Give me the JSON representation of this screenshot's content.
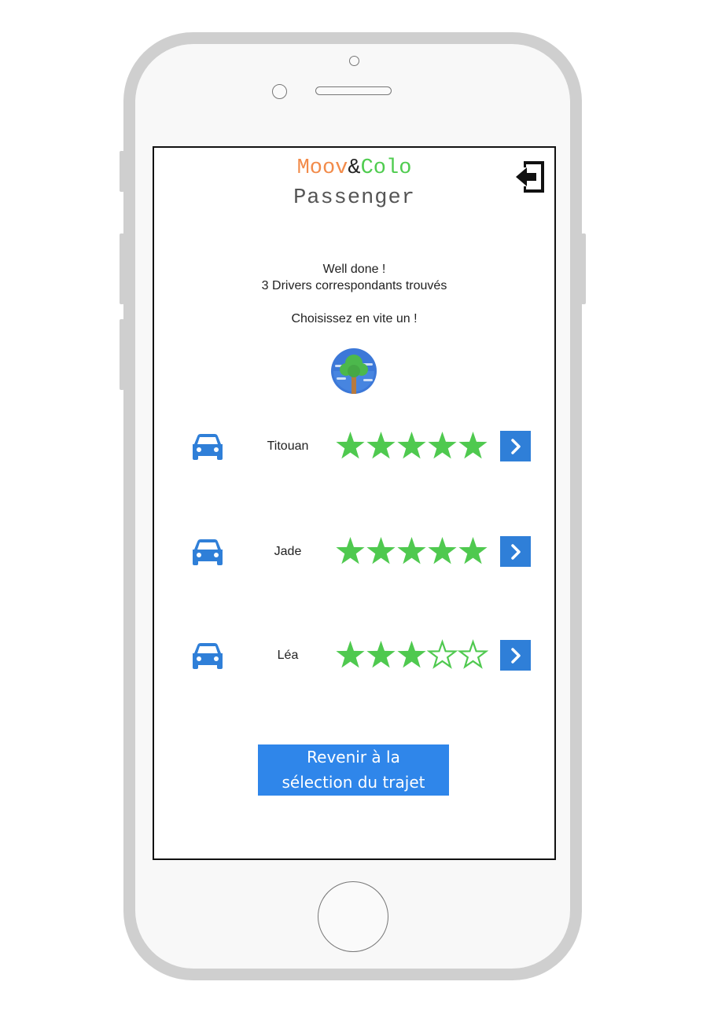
{
  "app": {
    "brand_part1": "Moov",
    "brand_amp": "&",
    "brand_part2": "Colo",
    "subtitle": "Passenger"
  },
  "message": {
    "line1": "Well done !",
    "line2": "3 Drivers correspondants trouvés",
    "line3": "Choisissez en vite un !"
  },
  "drivers": [
    {
      "name": "Titouan",
      "rating": 5,
      "max_rating": 5
    },
    {
      "name": "Jade",
      "rating": 5,
      "max_rating": 5
    },
    {
      "name": "Léa",
      "rating": 3,
      "max_rating": 5
    }
  ],
  "back_button": {
    "line1": "Revenir à la",
    "line2": "sélection du trajet"
  },
  "icons": {
    "logout": "logout-icon",
    "globe": "globe-tree-icon",
    "car": "car-icon",
    "star": "star-icon",
    "next": "chevron-right-icon"
  },
  "colors": {
    "accent_blue": "#2f7fd8",
    "star_green": "#4fc94f",
    "brand_orange": "#f28b4a",
    "brand_green": "#4fcc4f"
  }
}
